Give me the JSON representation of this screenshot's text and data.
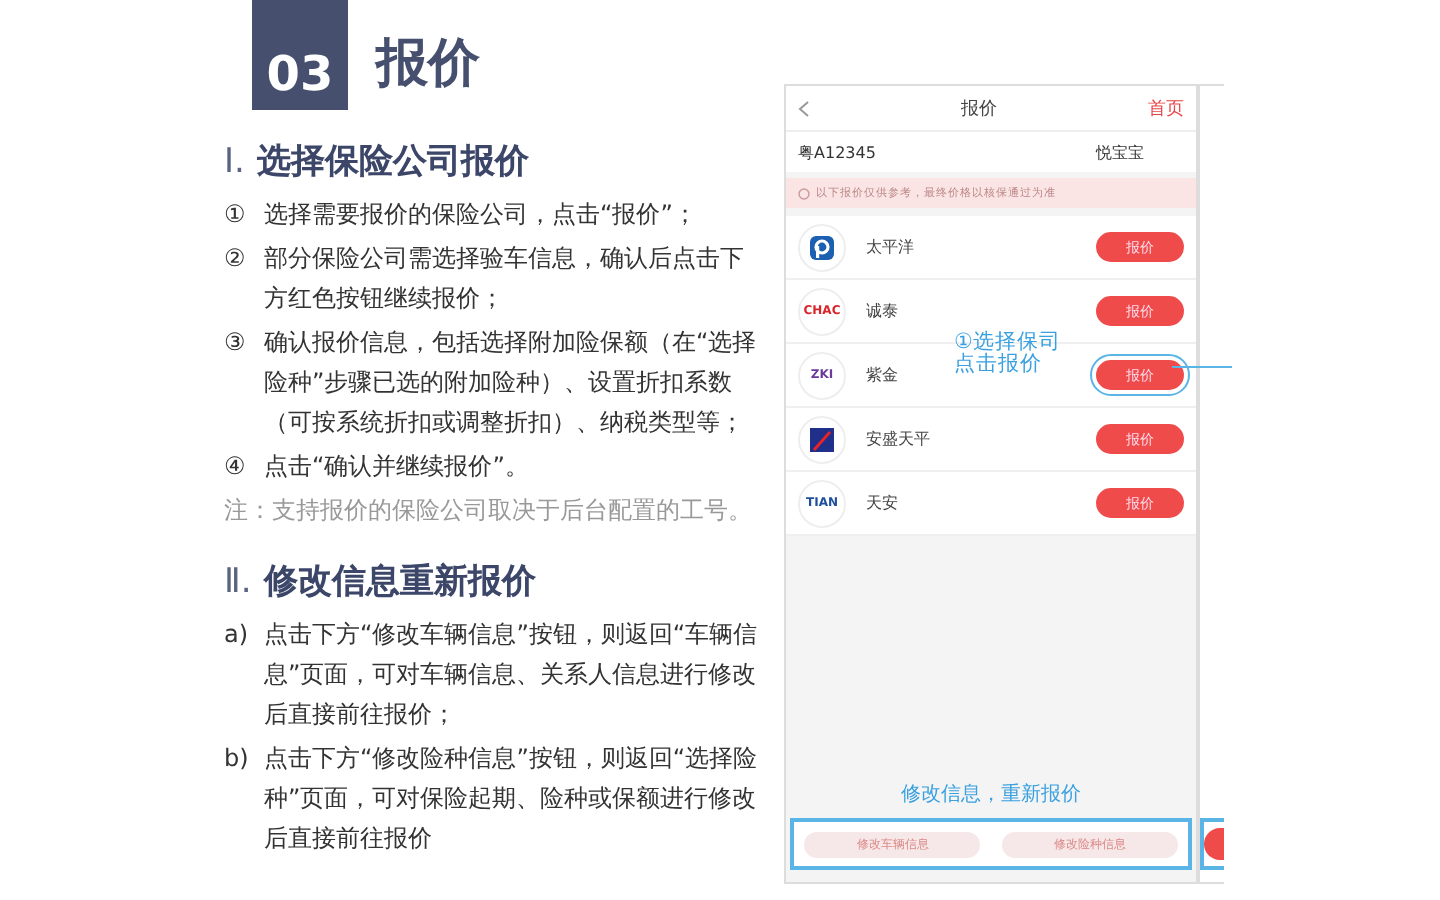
{
  "header": {
    "number": "03",
    "title": "报价"
  },
  "sections": [
    {
      "heading_num": "Ⅰ.",
      "heading": "选择保险公司报价",
      "items": [
        {
          "marker": "①",
          "text": "选择需要报价的保险公司，点击“报价”；"
        },
        {
          "marker": "②",
          "text": "部分保险公司需选择验车信息，确认后点击下方红色按钮继续报价；"
        },
        {
          "marker": "③",
          "text": "确认报价信息，包括选择附加险保额（在“选择险种”步骤已选的附加险种）、设置折扣系数（可按系统折扣或调整折扣）、纳税类型等；"
        },
        {
          "marker": "④",
          "text": "点击“确认并继续报价”。"
        }
      ],
      "note": "注：支持报价的保险公司取决于后台配置的工号。"
    },
    {
      "heading_num": "Ⅱ.",
      "heading": "修改信息重新报价",
      "items": [
        {
          "marker": "a)",
          "text": "点击下方“修改车辆信息”按钮，则返回“车辆信息”页面，可对车辆信息、关系人信息进行修改后直接前往报价；"
        },
        {
          "marker": "b)",
          "text": "点击下方“修改险种信息”按钮，则返回“选择险种”页面，可对保险起期、险种或保额进行修改后直接前往报价"
        }
      ]
    }
  ],
  "phone": {
    "title": "报价",
    "home_link": "首页",
    "plate": "粤A12345",
    "owner": "悦宝宝",
    "notice": "以下报价仅供参考，最终价格以核保通过为准",
    "companies": [
      {
        "name": "太平洋",
        "kind": "p-mark",
        "button": "报价",
        "highlighted": false
      },
      {
        "name": "诚泰",
        "kind": "text",
        "logo_text": "CHAC",
        "color": "#d9262c",
        "button": "报价",
        "highlighted": false
      },
      {
        "name": "紫金",
        "kind": "text",
        "logo_text": "ZKI",
        "color": "#6a3a9c",
        "button": "报价",
        "highlighted": true
      },
      {
        "name": "安盛天平",
        "kind": "axa-mark",
        "button": "报价",
        "highlighted": false
      },
      {
        "name": "天安",
        "kind": "text",
        "logo_text": "TIAN",
        "color": "#1d4f9c",
        "button": "报价",
        "highlighted": false
      }
    ],
    "callout": [
      "①选择保司",
      "点击报价"
    ],
    "bottom_caption": "修改信息，重新报价",
    "bottom_buttons": [
      "修改车辆信息",
      "修改险种信息"
    ]
  }
}
